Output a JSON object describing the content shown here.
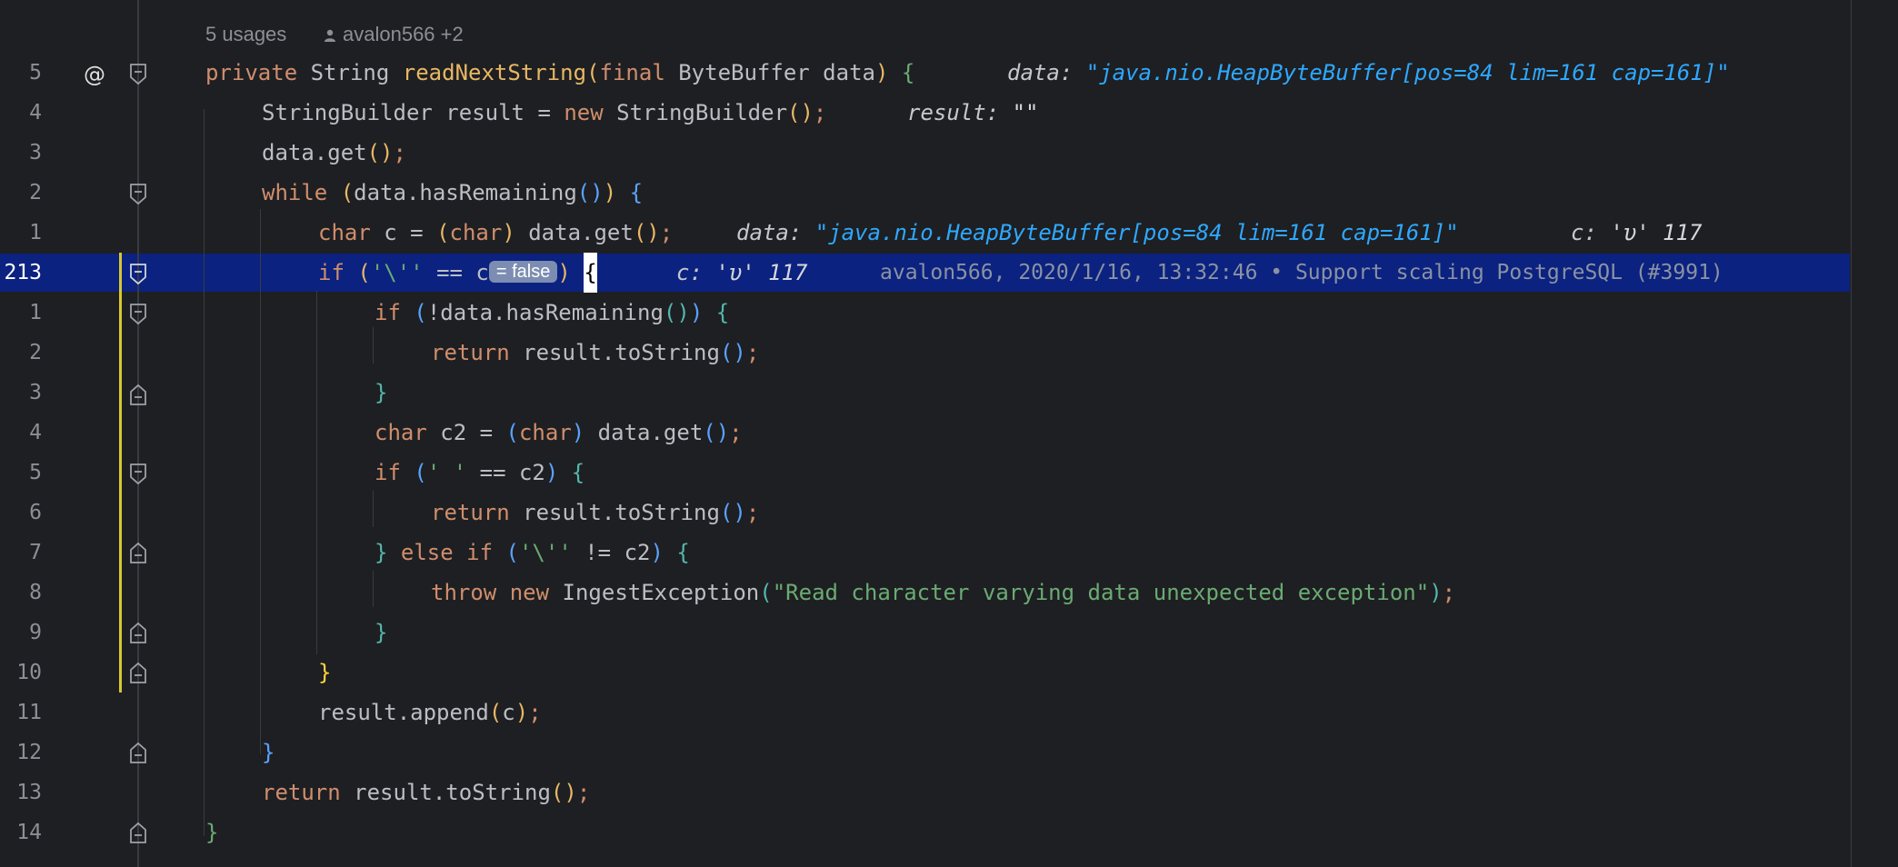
{
  "codeLens": {
    "usages": "5 usages",
    "author": "avalon566 +2"
  },
  "gutter": {
    "line_numbers": [
      "5",
      "4",
      "3",
      "2",
      "1",
      "213",
      "1",
      "2",
      "3",
      "4",
      "5",
      "6",
      "7",
      "8",
      "9",
      "10",
      "11",
      "12",
      "13",
      "14"
    ],
    "method_marker": "@",
    "current_line": "213"
  },
  "code": {
    "l1": {
      "private": "private",
      "String": "String",
      "name": "readNextString",
      "open": "(",
      "final": "final",
      "ByteBuffer": "ByteBuffer",
      "data": "data",
      "close": ")",
      "brace": "{"
    },
    "l2": {
      "type": "StringBuilder",
      "var": "result",
      "eq": "=",
      "new": "new",
      "ctor": "StringBuilder",
      "parens": "()",
      "semi": ";"
    },
    "l3": {
      "text": "data.get",
      "parens": "()",
      "semi": ";"
    },
    "l4": {
      "while": "while",
      "open": "(",
      "call": "data.hasRemaining",
      "parens": "()",
      "close": ")",
      "brace": "{"
    },
    "l5": {
      "char": "char",
      "var": "c",
      "eq": "=",
      "open": "(",
      "cast": "char",
      "close": ")",
      "call": "data.get",
      "parens": "()",
      "semi": ";"
    },
    "l6": {
      "if": "if",
      "open": "(",
      "lit": "'\\''",
      "op": "==",
      "var": "c",
      "badge": "= false",
      "close": ")",
      "brace": "{"
    },
    "l7": {
      "if": "if",
      "open": "(",
      "call": "!data.hasRemaining",
      "parens": "()",
      "close": ")",
      "brace": "{"
    },
    "l8": {
      "return": "return",
      "call": "result.toString",
      "parens": "()",
      "semi": ";"
    },
    "l9": {
      "brace": "}"
    },
    "l10": {
      "char": "char",
      "var": "c2",
      "eq": "=",
      "open": "(",
      "cast": "char",
      "close": ")",
      "call": "data.get",
      "parens": "()",
      "semi": ";"
    },
    "l11": {
      "if": "if",
      "open": "(",
      "lit": "' '",
      "op": "==",
      "var": "c2",
      "close": ")",
      "brace": "{"
    },
    "l12": {
      "return": "return",
      "call": "result.toString",
      "parens": "()",
      "semi": ";"
    },
    "l13": {
      "brace": "}",
      "else": "else",
      "if": "if",
      "open": "(",
      "lit": "'\\''",
      "op": "!=",
      "var": "c2",
      "close": ")",
      "brace2": "{"
    },
    "l14": {
      "throw": "throw",
      "new": "new",
      "cls": "IngestException",
      "open": "(",
      "str": "\"Read character varying data unexpected exception\"",
      "close": ")",
      "semi": ";"
    },
    "l15": {
      "brace": "}"
    },
    "l16": {
      "brace": "}"
    },
    "l17": {
      "call": "result.append",
      "open": "(",
      "var": "c",
      "close": ")",
      "semi": ";"
    },
    "l18": {
      "brace": "}"
    },
    "l19": {
      "return": "return",
      "call": "result.toString",
      "parens": "()",
      "semi": ";"
    },
    "l20": {
      "brace": "}"
    }
  },
  "hints": {
    "h1": {
      "label": "data:",
      "value": "\"java.nio.HeapByteBuffer[pos=84 lim=161 cap=161]\""
    },
    "h2": {
      "label": "result:",
      "value": "\"\""
    },
    "h5a": {
      "label": "data:",
      "value": "\"java.nio.HeapByteBuffer[pos=84 lim=161 cap=161]\""
    },
    "h5b": {
      "label": "c:",
      "value": "'υ' 117"
    },
    "h6": {
      "label": "c:",
      "value": "'υ' 117"
    }
  },
  "blame": "avalon566, 2020/1/16, 13:32:46 • Support scaling PostgreSQL (#3991)",
  "colors": {
    "background": "#1e1f22",
    "keyword": "#cf8e6d",
    "function": "#e8b765",
    "string": "#6aab73",
    "debug_value": "#2ea8ff",
    "current_line": "#0b2280",
    "modified_bar": "#d7c832"
  }
}
